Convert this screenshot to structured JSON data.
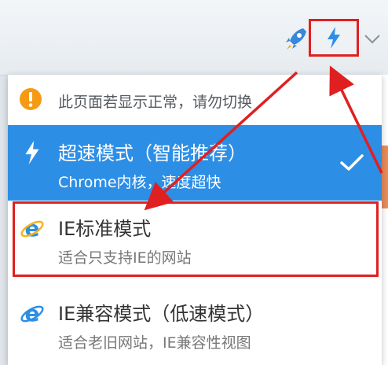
{
  "toolbar": {
    "rocket_icon": "rocket-icon",
    "mode_icon": "lightning-icon",
    "dropdown_icon": "chevron-down-icon"
  },
  "menu": {
    "notice": {
      "icon": "exclamation-icon",
      "text": "此页面若显示正常，请勿切换"
    },
    "items": [
      {
        "icon": "lightning-icon",
        "title": "超速模式（智能推荐）",
        "desc": "Chrome内核，速度超快",
        "selected": true
      },
      {
        "icon": "ie-icon",
        "title": "IE标准模式",
        "desc": "适合只支持IE的网站",
        "selected": false
      },
      {
        "icon": "ie-icon",
        "title": "IE兼容模式（低速模式）",
        "desc": "适合老旧网站，IE兼容性视图",
        "selected": false
      }
    ]
  },
  "colors": {
    "accent": "#2d8ee6",
    "highlight": "#e02020",
    "notice": "#f59a12"
  }
}
